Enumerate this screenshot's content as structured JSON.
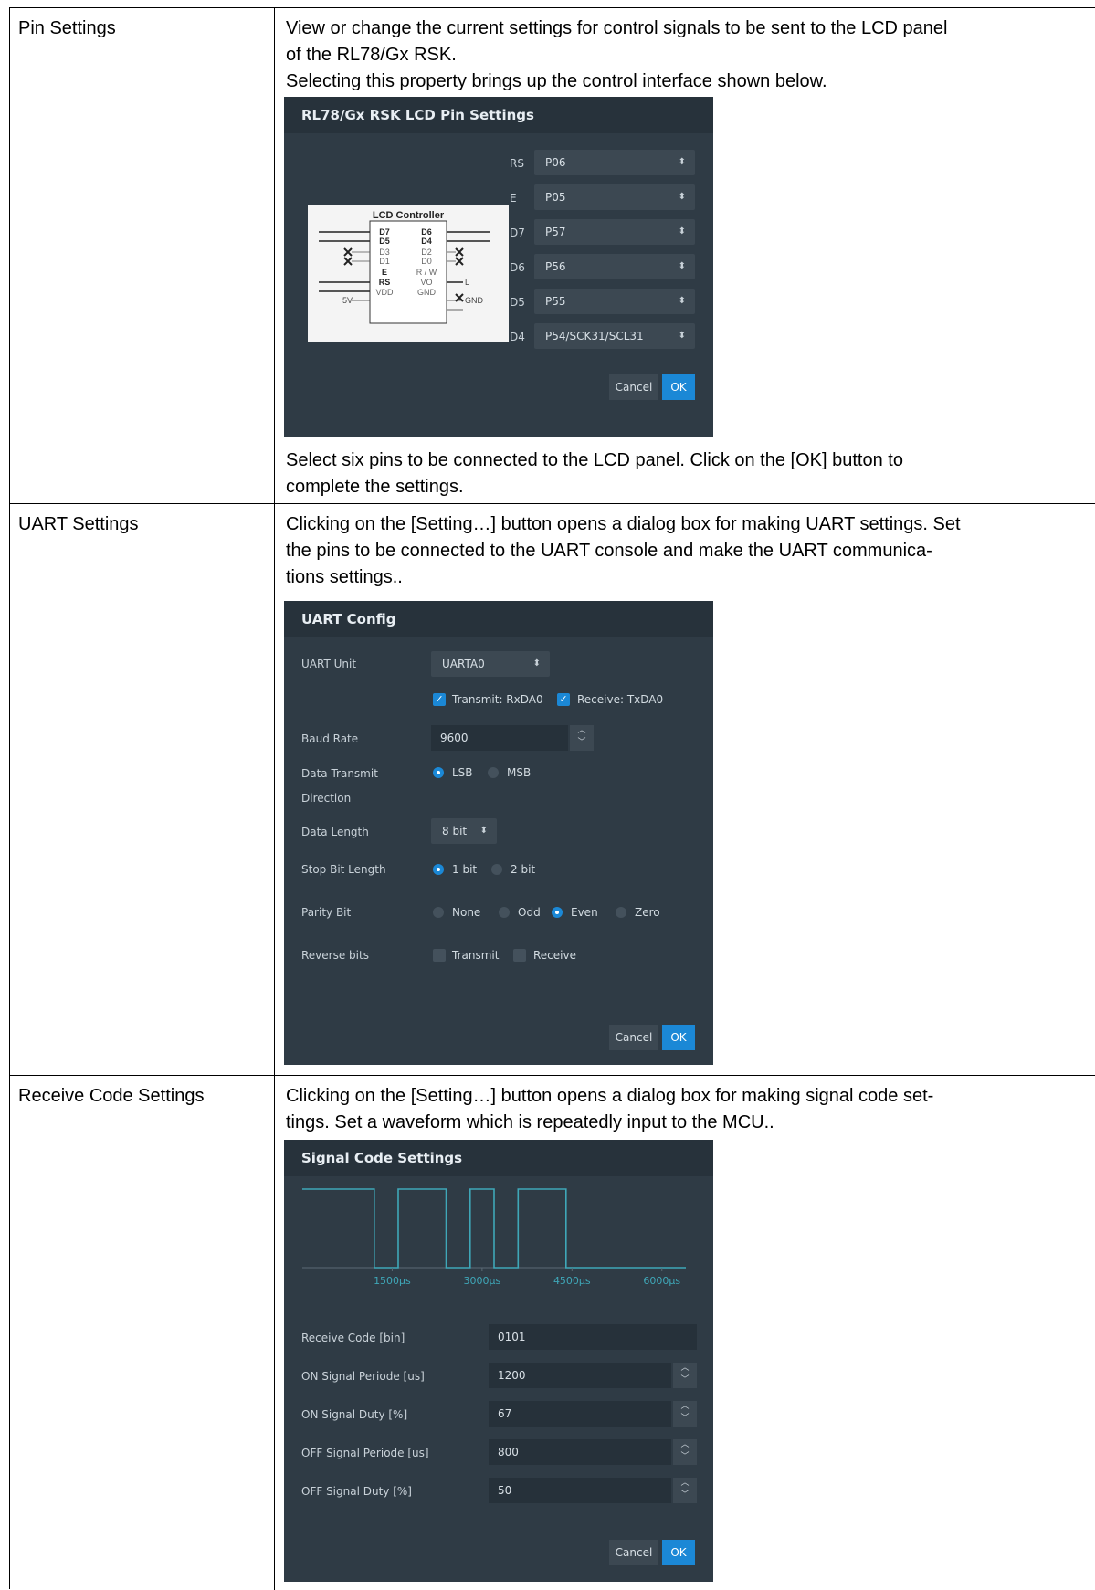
{
  "rows": [
    {
      "label": "Pin Settings",
      "intro_1": "View or change the current settings for control signals to be sent to the LCD panel",
      "intro_2": "of the RL78/Gx RSK.",
      "intro_3": "Selecting this property brings up the control interface shown below.",
      "outro_1": "Select six pins to be connected to the LCD panel. Click on the [OK] button to",
      "outro_2": "complete the settings."
    },
    {
      "label": "UART Settings",
      "intro_1": "Clicking on the [Setting…] button opens a dialog box for making UART settings. Set",
      "intro_2": "the pins to be connected to the UART console and make the UART communica-",
      "intro_3": "tions settings.."
    },
    {
      "label": "Receive Code Settings",
      "intro_1": "Clicking on the [Setting…] button opens a dialog box for making signal code set-",
      "intro_2": "tings. Set a waveform which is repeatedly input to the MCU.."
    }
  ],
  "lcd_dialog": {
    "title": "RL78/Gx RSK LCD Pin Settings",
    "diagram": {
      "title": "LCD Controller",
      "left_pins": [
        "D7",
        "D5",
        "D3",
        "D1",
        "E",
        "RS",
        "VDD"
      ],
      "right_pins": [
        "D6",
        "D4",
        "D2",
        "D0",
        "R / W",
        "VO",
        "GND"
      ],
      "left_ext": "5V",
      "right_ext_l": "L",
      "right_ext_gnd": "GND"
    },
    "pins": [
      {
        "name": "RS",
        "value": "P06"
      },
      {
        "name": "E",
        "value": "P05"
      },
      {
        "name": "D7",
        "value": "P57"
      },
      {
        "name": "D6",
        "value": "P56"
      },
      {
        "name": "D5",
        "value": "P55"
      },
      {
        "name": "D4",
        "value": "P54/SCK31/SCL31"
      }
    ],
    "cancel": "Cancel",
    "ok": "OK"
  },
  "uart_dialog": {
    "title": "UART Config",
    "unit_label": "UART Unit",
    "unit_value": "UARTA0",
    "transmit_check": "Transmit: RxDA0",
    "receive_check": "Receive: TxDA0",
    "baud_label": "Baud Rate",
    "baud_value": "9600",
    "direction_label_1": "Data Transmit",
    "direction_label_2": "Direction",
    "direction_options": [
      "LSB",
      "MSB"
    ],
    "direction_selected": "LSB",
    "length_label": "Data Length",
    "length_value": "8 bit",
    "stop_label": "Stop Bit Length",
    "stop_options": [
      "1 bit",
      "2 bit"
    ],
    "stop_selected": "1 bit",
    "parity_label": "Parity Bit",
    "parity_options": [
      "None",
      "Odd",
      "Even",
      "Zero"
    ],
    "parity_selected": "Even",
    "reverse_label": "Reverse bits",
    "reverse_options": [
      "Transmit",
      "Receive"
    ],
    "cancel": "Cancel",
    "ok": "OK"
  },
  "signal_dialog": {
    "title": "Signal Code Settings",
    "chart_data": {
      "type": "line",
      "x_ticks": [
        "1500μs",
        "3000μs",
        "4500μs",
        "6000μs"
      ],
      "xlim": [
        0,
        6400
      ],
      "waveform_points": [
        [
          0,
          1
        ],
        [
          1200,
          1
        ],
        [
          1200,
          0
        ],
        [
          1600,
          0
        ],
        [
          1600,
          1
        ],
        [
          2400,
          1
        ],
        [
          2400,
          0
        ],
        [
          2800,
          0
        ],
        [
          2800,
          1
        ],
        [
          3200,
          1
        ],
        [
          3200,
          0
        ],
        [
          3600,
          0
        ],
        [
          3600,
          1
        ],
        [
          4400,
          1
        ],
        [
          4400,
          0
        ],
        [
          6400,
          0
        ]
      ]
    },
    "fields": [
      {
        "label": "Receive Code [bin]",
        "value": "0101",
        "spinner": false
      },
      {
        "label": "ON Signal Periode [us]",
        "value": "1200",
        "spinner": true
      },
      {
        "label": "ON Signal Duty [%]",
        "value": "67",
        "spinner": true
      },
      {
        "label": "OFF Signal Periode [us]",
        "value": "800",
        "spinner": true
      },
      {
        "label": "OFF Signal Duty [%]",
        "value": "50",
        "spinner": true
      }
    ],
    "cancel": "Cancel",
    "ok": "OK"
  },
  "colors": {
    "dialog_bg": "#2f3b45",
    "accent": "#1b88d6",
    "waveform": "#3fa7b8"
  }
}
